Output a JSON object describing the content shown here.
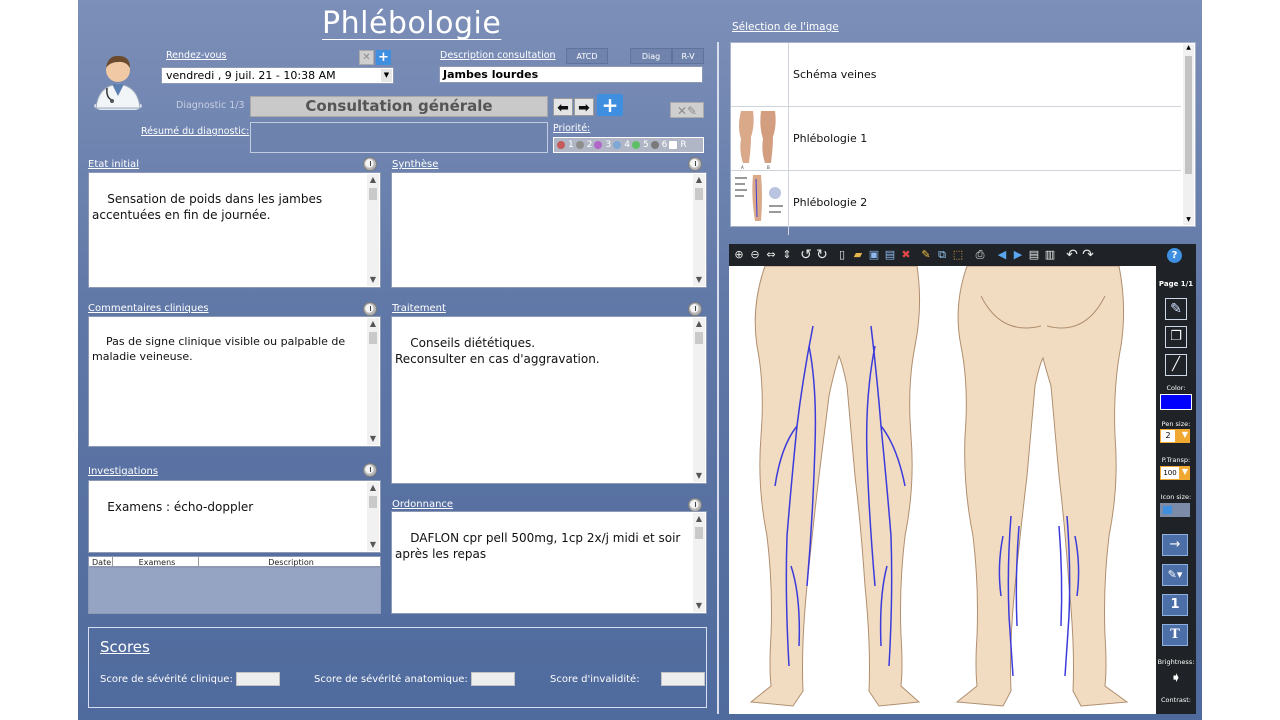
{
  "app": {
    "title": "Phlébologie"
  },
  "rdv": {
    "label": "Rendez-vous",
    "value": "vendredi ,   9  juil.  21 - 10:38 AM"
  },
  "consult": {
    "label": "Description consultation",
    "value": "Jambes lourdes",
    "tabs": [
      "ATCD",
      "Diag",
      "R-V"
    ]
  },
  "diagnostic": {
    "label": "Diagnostic 1/3",
    "value": "Consultation générale",
    "summary_label": "Résumé du diagnostic:",
    "summary_value": ""
  },
  "priority": {
    "label": "Priorité:",
    "levels": [
      "1",
      "2",
      "3",
      "4",
      "5",
      "6",
      "R"
    ],
    "colors": [
      "#c45a5a",
      "#8e8e8e",
      "#b267c8",
      "#7fa7d6",
      "#5fbf66",
      "#7a7a7a",
      "#ffffff"
    ]
  },
  "sections": {
    "etat_initial": {
      "label": "Etat initial",
      "text": "Sensation de poids dans les jambes accentuées en fin de journée."
    },
    "synthese": {
      "label": "Synthèse",
      "text": ""
    },
    "commentaires": {
      "label": "Commentaires cliniques",
      "text": "Pas de signe clinique visible ou palpable de maladie veineuse."
    },
    "traitement": {
      "label": "Traitement",
      "text": "Conseils diététiques.\nReconsulter en cas d'aggravation."
    },
    "investigations": {
      "label": "Investigations",
      "text": "Examens : écho-doppler"
    },
    "ordonnance": {
      "label": "Ordonnance",
      "text": "DAFLON cpr pell 500mg, 1cp 2x/j midi et soir après les repas"
    }
  },
  "exam_table": {
    "columns": [
      "Date",
      "Examens",
      "Description"
    ]
  },
  "scores": {
    "title": "Scores",
    "items": [
      "Score de sévérité clinique:",
      "Score de sévérité anatomique:",
      "Score d'invalidité:"
    ]
  },
  "image_selection": {
    "label": "Sélection de l'image",
    "items": [
      "Schéma veines",
      "Phlébologie 1",
      "Phlébologie 2"
    ]
  },
  "viewer": {
    "page": "Page 1/1",
    "labels": {
      "color": "Color:",
      "pen_size": "Pen size:",
      "transp": "P.Transp:",
      "icon_size": "Icon size:",
      "brightness": "Brightness:",
      "contrast": "Contrast:"
    },
    "pen_size_value": "2",
    "transp_value": "100",
    "pen_color": "#0000ff",
    "vein_color": "#3b3bdc",
    "number_tool": "1",
    "text_tool": "T"
  }
}
